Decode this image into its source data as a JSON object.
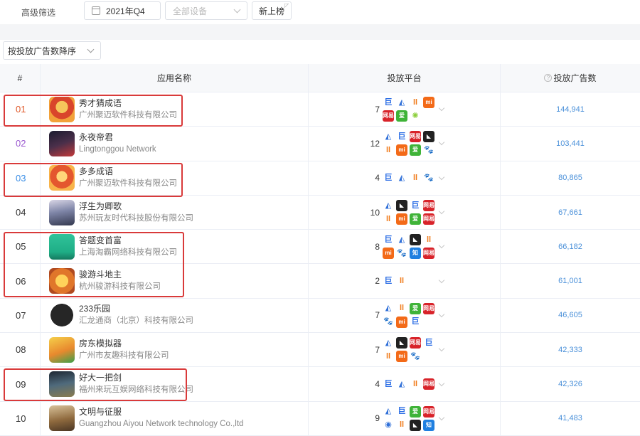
{
  "filters": {
    "label": "高级筛选",
    "date": "2021年Q4",
    "device_placeholder": "全部设备",
    "new_button": "新上榜"
  },
  "sort": {
    "selected": "按投放广告数降序"
  },
  "table": {
    "columns": [
      "#",
      "应用名称",
      "投放平台",
      "投放广告数"
    ],
    "rows": [
      {
        "rank": "01",
        "name": "秀才猜成语",
        "company": "广州聚迈软件科技有限公司",
        "platform_count": "7",
        "platforms": [
          "juliang",
          "baidu-ad",
          "kuaishou",
          "xiaomi",
          "wangyi",
          "iqiyi",
          "sun"
        ],
        "ads": "144,941",
        "rank_color": "#e0592a",
        "icon": "icon-caishen"
      },
      {
        "rank": "02",
        "name": "永夜帝君",
        "company": "Lingtonggou Network",
        "platform_count": "12",
        "platforms": [
          "baidu-ad",
          "juliang",
          "wangyi",
          "vivo",
          "kuaishou",
          "xiaomi",
          "iqiyi",
          "baidu"
        ],
        "ads": "103,441",
        "rank_color": "#9b59d0",
        "icon": "icon-dark"
      },
      {
        "rank": "03",
        "name": "多多成语",
        "company": "广州聚迈软件科技有限公司",
        "platform_count": "4",
        "platforms": [
          "juliang",
          "baidu-ad",
          "kuaishou",
          "baidu"
        ],
        "ads": "80,865",
        "rank_color": "#3a8ee6",
        "icon": "icon-caishen2"
      },
      {
        "rank": "04",
        "name": "浮生为卿歌",
        "company": "苏州玩友时代科技股份有限公司",
        "platform_count": "10",
        "platforms": [
          "baidu-ad",
          "vivo",
          "juliang",
          "wangyi",
          "kuaishou",
          "xiaomi",
          "iqiyi",
          "wangyi"
        ],
        "ads": "67,661",
        "rank_color": "#333333",
        "icon": "icon-girl"
      },
      {
        "rank": "05",
        "name": "答题变首富",
        "company": "上海淘霸网络科技有限公司",
        "platform_count": "8",
        "platforms": [
          "juliang",
          "baidu-ad",
          "vivo",
          "kuaishou",
          "xiaomi",
          "baidu",
          "zhihu",
          "wangyi"
        ],
        "ads": "66,182",
        "rank_color": "#333333",
        "icon": "icon-green"
      },
      {
        "rank": "06",
        "name": "骏游斗地主",
        "company": "杭州骏游科技有限公司",
        "platform_count": "2",
        "platforms": [
          "juliang",
          "kuaishou"
        ],
        "ads": "61,001",
        "rank_color": "#333333",
        "icon": "icon-doudizhu"
      },
      {
        "rank": "07",
        "name": "233乐园",
        "company": "汇龙通商（北京）科技有限公司",
        "platform_count": "7",
        "platforms": [
          "baidu-ad",
          "kuaishou",
          "iqiyi",
          "wangyi",
          "baidu",
          "xiaomi",
          "juliang"
        ],
        "ads": "46,605",
        "rank_color": "#333333",
        "icon": "icon-233"
      },
      {
        "rank": "08",
        "name": "房东模拟器",
        "company": "广州市友趣科技有限公司",
        "platform_count": "7",
        "platforms": [
          "baidu-ad",
          "vivo",
          "wangyi",
          "juliang",
          "kuaishou",
          "xiaomi",
          "baidu"
        ],
        "ads": "42,333",
        "rank_color": "#333333",
        "icon": "icon-fangdong"
      },
      {
        "rank": "09",
        "name": "好大一把剑",
        "company": "福州来玩互娱网络科技有限公司",
        "platform_count": "4",
        "platforms": [
          "juliang",
          "baidu-ad",
          "kuaishou",
          "wangyi"
        ],
        "ads": "42,326",
        "rank_color": "#333333",
        "icon": "icon-sword"
      },
      {
        "rank": "10",
        "name": "文明与征服",
        "company": "Guangzhou Aiyou Network technology Co.,ltd",
        "platform_count": "9",
        "platforms": [
          "baidu-ad",
          "juliang",
          "iqiyi",
          "wangyi",
          "tencent",
          "kuaishou",
          "vivo",
          "zhihu"
        ],
        "ads": "41,483",
        "rank_color": "#333333",
        "icon": "icon-warrior"
      }
    ]
  },
  "platform_styles": {
    "juliang": {
      "glyph": "巨",
      "bg": "#ffffff",
      "fg": "#2b6de5"
    },
    "baidu-ad": {
      "glyph": "◭",
      "bg": "#ffffff",
      "fg": "#2f6fd8"
    },
    "kuaishou": {
      "glyph": "ll",
      "bg": "#ffffff",
      "fg": "#f07b1a"
    },
    "xiaomi": {
      "glyph": "mi",
      "bg": "#f36a18",
      "fg": "#ffffff"
    },
    "wangyi": {
      "glyph": "网易",
      "bg": "#d8232a",
      "fg": "#ffffff"
    },
    "iqiyi": {
      "glyph": "爱",
      "bg": "#3fb338",
      "fg": "#ffffff"
    },
    "sun": {
      "glyph": "✺",
      "bg": "#ffffff",
      "fg": "#8ccf3c"
    },
    "vivo": {
      "glyph": "◣",
      "bg": "#222222",
      "fg": "#ffffff"
    },
    "baidu": {
      "glyph": "🐾",
      "bg": "#ffffff",
      "fg": "#2f6fd8"
    },
    "zhihu": {
      "glyph": "知",
      "bg": "#1f7fe0",
      "fg": "#ffffff"
    },
    "tencent": {
      "glyph": "◉",
      "bg": "#ffffff",
      "fg": "#2f6fd8"
    }
  },
  "icon_styles": {
    "icon-caishen": "radial-gradient(circle at 50% 40%, #f6c65b 0 30%, #d9452b 31% 60%, #f2a23a 61%)",
    "icon-dark": "linear-gradient(160deg, #1b1b2f 0%, #4a2f4a 50%, #c43a3a 100%)",
    "icon-caishen2": "radial-gradient(circle at 50% 45%, #ffd77a 0 28%, #e4572e 29% 62%, #f8b44a 63%)",
    "icon-girl": "linear-gradient(170deg, #d9d6e6 0%, #7f86a8 45%, #33384f 100%)",
    "icon-green": "linear-gradient(180deg, #30c39a 0%, #1fae86 70%, #157a5f 100%)",
    "icon-doudizhu": "radial-gradient(circle at 50% 50%, #ffd25a 0 35%, #e0762a 36% 70%, #b04a20 71%)",
    "icon-233": "radial-gradient(circle at 50% 50%, #262626 0 62%, #ffffff 63%)",
    "icon-fangdong": "linear-gradient(160deg, #f5d04a 0%, #e8892e 55%, #3aa04a 100%)",
    "icon-sword": "linear-gradient(170deg, #1e2733 0%, #4f6a7c 50%, #8a7b4e 100%)",
    "icon-warrior": "linear-gradient(170deg, #d8c29a 0%, #8f6a3e 55%, #4a3624 100%)"
  },
  "highlight_color": "#d93a3a"
}
